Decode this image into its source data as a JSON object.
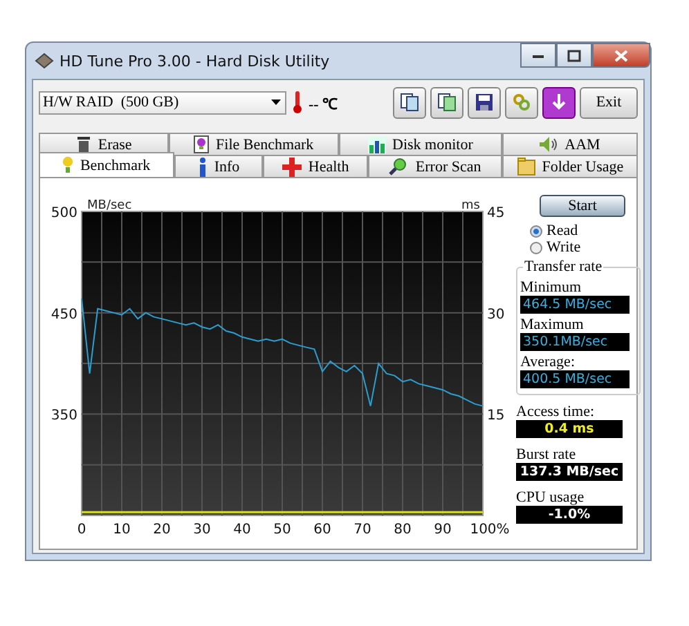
{
  "window": {
    "title": "HD Tune Pro 3.00 - Hard Disk Utility"
  },
  "toolbar": {
    "drive": "H/W RAID  (500 GB)",
    "temperature": "-- ℃",
    "exit": "Exit"
  },
  "tabs": [
    [
      {
        "label": "Erase",
        "kind": "erase",
        "selected": false
      },
      {
        "label": "File Benchmark",
        "kind": "file_benchmark",
        "selected": false
      },
      {
        "label": "Disk monitor",
        "kind": "disk_monitor",
        "selected": false
      },
      {
        "label": "AAM",
        "kind": "aam",
        "selected": false
      }
    ],
    [
      {
        "label": "Benchmark",
        "kind": "benchmark",
        "selected": true
      },
      {
        "label": "Info",
        "kind": "info",
        "selected": false
      },
      {
        "label": "Health",
        "kind": "health",
        "selected": false
      },
      {
        "label": "Error Scan",
        "kind": "error_scan",
        "selected": false
      },
      {
        "label": "Folder Usage",
        "kind": "folder_usage",
        "selected": false
      }
    ]
  ],
  "graph": {
    "left_unit": "MB/sec",
    "left_ticks": [
      "500",
      "450",
      "350"
    ],
    "chart_data": {
      "type": "line",
      "ylabel": "ms",
      "xlim": [
        0,
        100
      ],
      "ylim": [
        0,
        45
      ],
      "grid": true,
      "xticks": [
        0,
        10,
        20,
        30,
        40,
        50,
        60,
        70,
        80,
        90,
        {
          "value": 100,
          "label": "100%"
        }
      ],
      "yticks": [
        45,
        30,
        15
      ],
      "x": [
        0,
        2,
        4,
        6,
        8,
        10,
        12,
        14,
        16,
        18,
        20,
        22,
        24,
        26,
        28,
        30,
        32,
        34,
        36,
        38,
        40,
        42,
        44,
        46,
        48,
        50,
        52,
        54,
        56,
        58,
        60,
        62,
        64,
        66,
        68,
        70,
        72,
        74,
        76,
        78,
        80,
        82,
        84,
        86,
        88,
        90,
        92,
        94,
        96,
        98,
        100
      ],
      "series": [
        {
          "color": "#2a9fd0",
          "values": [
            32.1,
            21,
            30.6,
            30.3,
            30,
            29.7,
            30.6,
            29.1,
            30,
            29.4,
            29.1,
            28.8,
            28.5,
            28.2,
            28.5,
            27.9,
            27.6,
            28.2,
            27.3,
            27,
            26.4,
            26.1,
            25.8,
            26.1,
            25.8,
            26.1,
            25.5,
            25.2,
            24.9,
            24.6,
            21.3,
            22.8,
            21.9,
            21.3,
            22.2,
            21,
            16.2,
            22.5,
            21,
            20.7,
            19.8,
            20.1,
            19.5,
            19.2,
            18.9,
            18.6,
            18,
            17.7,
            17.1,
            16.5,
            16.2
          ]
        },
        {
          "color": "#dddd22",
          "values": [
            0.5,
            0.5,
            0.5,
            0.5,
            0.5,
            0.5,
            0.5,
            0.5,
            0.5,
            0.5,
            0.5,
            0.5,
            0.5,
            0.5,
            0.5,
            0.5,
            0.5,
            0.5,
            0.5,
            0.5,
            0.5,
            0.5,
            0.5,
            0.5,
            0.5,
            0.5,
            0.5,
            0.5,
            0.5,
            0.5,
            0.5,
            0.5,
            0.5,
            0.5,
            0.5,
            0.5,
            0.5,
            0.5,
            0.5,
            0.5,
            0.5,
            0.5,
            0.5,
            0.5,
            0.5,
            0.5,
            0.5,
            0.5,
            0.5,
            0.5,
            0.5
          ]
        }
      ]
    }
  },
  "panel": {
    "start": "Start",
    "modes": [
      {
        "label": "Read",
        "selected": true
      },
      {
        "label": "Write",
        "selected": false
      }
    ],
    "transfer_rate": {
      "title": "Transfer rate",
      "readings": [
        {
          "label": "Minimum",
          "value": "464.5 MB/sec"
        },
        {
          "label": "Maximum",
          "value": "350.1MB/sec"
        },
        {
          "label": "Average:",
          "value": "400.5 MB/sec"
        }
      ]
    },
    "stats": [
      {
        "label": "Access time:",
        "value": "0.4 ms"
      },
      {
        "label": "Burst rate",
        "value": "137.3 MB/sec"
      },
      {
        "label": "CPU usage",
        "value": "-1.0%"
      }
    ]
  }
}
